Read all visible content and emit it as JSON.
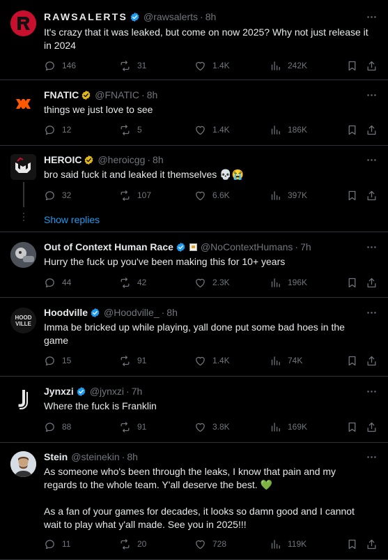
{
  "tweets": [
    {
      "name": "RAWSALERTS",
      "handle": "@rawsalerts",
      "dot": "·",
      "time": "8h",
      "verified": "blue",
      "text": "It's crazy that it was leaked, but come on now 2025? Why not just release it\nin 2024",
      "replies": "146",
      "retweets": "31",
      "likes": "1.4K",
      "views": "242K",
      "avatar": "raws-logo"
    },
    {
      "name": "FNATIC",
      "handle": "@FNATIC",
      "dot": "·",
      "time": "8h",
      "verified": "gold",
      "text": "things we just love to see",
      "replies": "12",
      "retweets": "5",
      "likes": "1.4K",
      "views": "186K",
      "avatar": "fnatic-logo"
    },
    {
      "name": "HEROIC",
      "handle": "@heroicgg",
      "dot": "·",
      "time": "8h",
      "verified": "gold",
      "text": "bro said fuck it and leaked it themselves 💀😭",
      "replies": "32",
      "retweets": "107",
      "likes": "6.6K",
      "views": "397K",
      "avatar": "heroic-logo"
    },
    {
      "name": "Out of Context Human Race",
      "handle": "@NoContextHumans",
      "dot": "·",
      "time": "7h",
      "verified": "blue",
      "text": "Hurry the fuck up you've been making this for 10+ years",
      "replies": "44",
      "retweets": "42",
      "likes": "2.3K",
      "views": "196K",
      "avatar": "photo"
    },
    {
      "name": "Hoodville",
      "handle": "@Hoodville_",
      "dot": "·",
      "time": "8h",
      "verified": "blue",
      "text": "Imma be bricked up while playing, yall done put some bad hoes in the\ngame",
      "replies": "15",
      "retweets": "91",
      "likes": "1.4K",
      "views": "74K",
      "avatar": "hoodville-logo"
    },
    {
      "name": "Jynxzi",
      "handle": "@jynxzi",
      "dot": "·",
      "time": "7h",
      "verified": "blue",
      "text": "Where the fuck is Franklin",
      "replies": "88",
      "retweets": "91",
      "likes": "3.8K",
      "views": "169K",
      "avatar": "jynxzi-logo"
    },
    {
      "name": "Stein",
      "handle": "@steinekin",
      "dot": "·",
      "time": "8h",
      "verified": "none",
      "text": "As someone who's been through the leaks, I know that pain and my\nregards to the whole team. Y'all deserve the best. 💚\n\nAs a fan of your games for decades, it looks so damn good and I cannot\nwait to play what y'all made. See you in 2025!!!",
      "replies": "11",
      "retweets": "20",
      "likes": "728",
      "views": "119K",
      "avatar": "photo"
    }
  ],
  "show_replies_label": "Show replies",
  "colors": {
    "background": "#000000",
    "text": "#e7e9ea",
    "muted": "#71767b",
    "accent": "#1d9bf0",
    "divider": "#2f3336"
  }
}
